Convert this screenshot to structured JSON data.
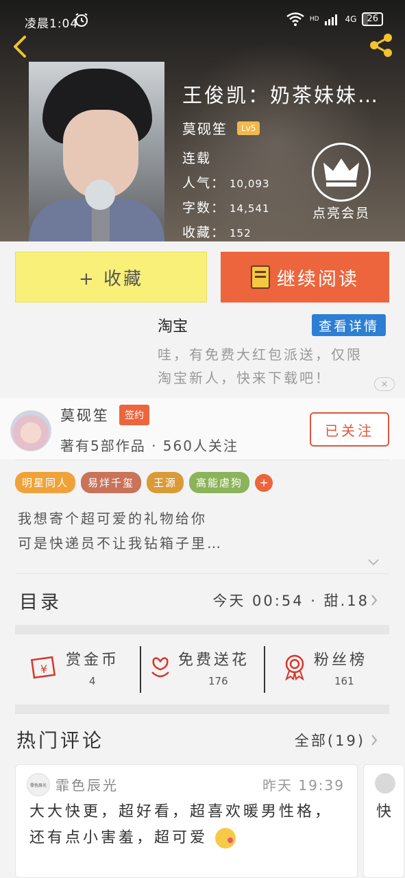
{
  "status_bar": {
    "time": "凌晨1:04",
    "network": "4G",
    "hd": "HD",
    "battery": "26"
  },
  "book": {
    "title": "王俊凯：奶茶妹妹…",
    "author": "莫砚笙",
    "level": "Lv5",
    "status": "连载",
    "popularity_label": "人气：",
    "popularity": "10,093",
    "words_label": "字数：",
    "words": "14,541",
    "favorites_label": "收藏：",
    "favorites": "152"
  },
  "vip": {
    "label": "点亮会员"
  },
  "actions": {
    "collect": "+ 收藏",
    "continue_read": "继续阅读"
  },
  "ad": {
    "brand": "淘宝",
    "button": "查看详情",
    "text_line1": "哇，有免费大红包派送，仅限",
    "text_line2": "淘宝新人，快来下载吧！",
    "close": "×"
  },
  "author_card": {
    "name": "莫砚笙",
    "badge": "签约",
    "stats": "著有5部作品 · 560人关注",
    "follow": "已关注"
  },
  "tags": [
    {
      "label": "明星同人",
      "color": "#f0a23a"
    },
    {
      "label": "易烊千玺",
      "color": "#c8735a"
    },
    {
      "label": "王源",
      "color": "#d99b38"
    },
    {
      "label": "高能虐狗",
      "color": "#8bb35a"
    }
  ],
  "tag_add": "+",
  "intro": {
    "line1": "我想寄个超可爱的礼物给你",
    "line2": "可是快递员不让我钻箱子里…"
  },
  "catalog": {
    "title": "目录",
    "update": "今天 00:54 · 甜.18"
  },
  "stats": [
    {
      "label": "赏金币",
      "value": "4",
      "icon": "red-envelope-icon"
    },
    {
      "label": "免费送花",
      "value": "176",
      "icon": "flower-icon"
    },
    {
      "label": "粉丝榜",
      "value": "161",
      "icon": "medal-icon"
    }
  ],
  "comments": {
    "title": "热门评论",
    "all": "全部(19)",
    "items": [
      {
        "user": "霏色辰光",
        "time": "昨天 19:39",
        "avatar_text": "霏色辰光",
        "body": "大大快更，超好看，超喜欢暖男性格，还有点小害羞，超可爱"
      }
    ],
    "peek_text": "快"
  },
  "colors": {
    "accent_orange": "#ec653c",
    "collect_yellow": "#f9f07a",
    "ad_blue": "#2d7fd4",
    "follow_red": "#e2553b"
  }
}
